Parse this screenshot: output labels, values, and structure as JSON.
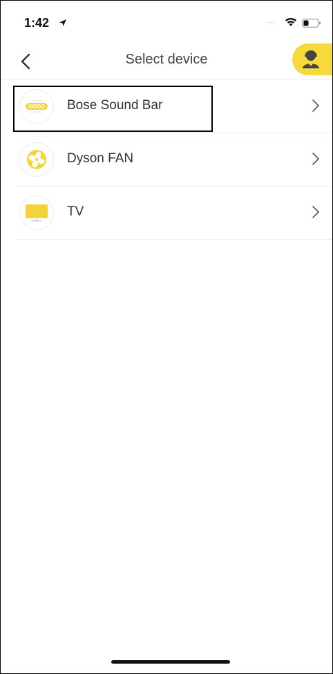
{
  "status_bar": {
    "time": "1:42",
    "signal": "....",
    "icons": [
      "location-arrow-icon",
      "wifi-icon",
      "battery-icon"
    ]
  },
  "nav": {
    "title": "Select device",
    "back_icon": "chevron-left-icon",
    "support_icon": "customer-support-icon"
  },
  "devices": [
    {
      "label": "Bose Sound Bar",
      "icon": "sound-bar-icon"
    },
    {
      "label": "Dyson FAN",
      "icon": "fan-icon"
    },
    {
      "label": "TV",
      "icon": "tv-icon"
    }
  ],
  "colors": {
    "accent": "#f6da3b",
    "icon_yellow": "#f2d43a",
    "text": "#333333",
    "divider": "#ececec"
  }
}
